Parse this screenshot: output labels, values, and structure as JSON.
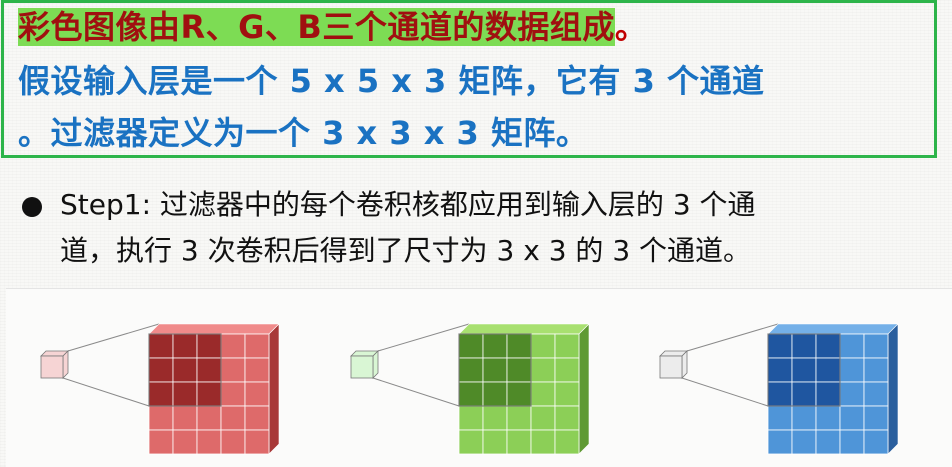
{
  "header": {
    "line1_parts": [
      "彩色图像由",
      "R、G、B",
      "三个通道的数据组成",
      "。"
    ],
    "line2": "假设输入层是一个 5 x 5 x 3 矩阵，它有 3 个通道",
    "line3": "。过滤器定义为一个 3 x 3 x 3 矩阵。"
  },
  "step": {
    "label": "Step1",
    "line1_rest": ": 过滤器中的每个卷积核都应用到输入层的 3 个通",
    "line2": "道，执行 3 次卷积后得到了尺寸为 3 x 3 的 3 个通道。"
  },
  "channels": [
    {
      "name": "red",
      "front": "#de6a6a",
      "top": "#f08a8a",
      "side": "#a83838",
      "dark": "#9a2a2a",
      "small": "#f6d4d4"
    },
    {
      "name": "green",
      "front": "#8ccf57",
      "top": "#a8e070",
      "side": "#5f9a33",
      "dark": "#4f8a28",
      "small": "#d9f6d4"
    },
    {
      "name": "blue",
      "front": "#4f95d8",
      "top": "#74b0e8",
      "side": "#2a5f9e",
      "dark": "#1f56a0",
      "small": "#ececec"
    }
  ]
}
